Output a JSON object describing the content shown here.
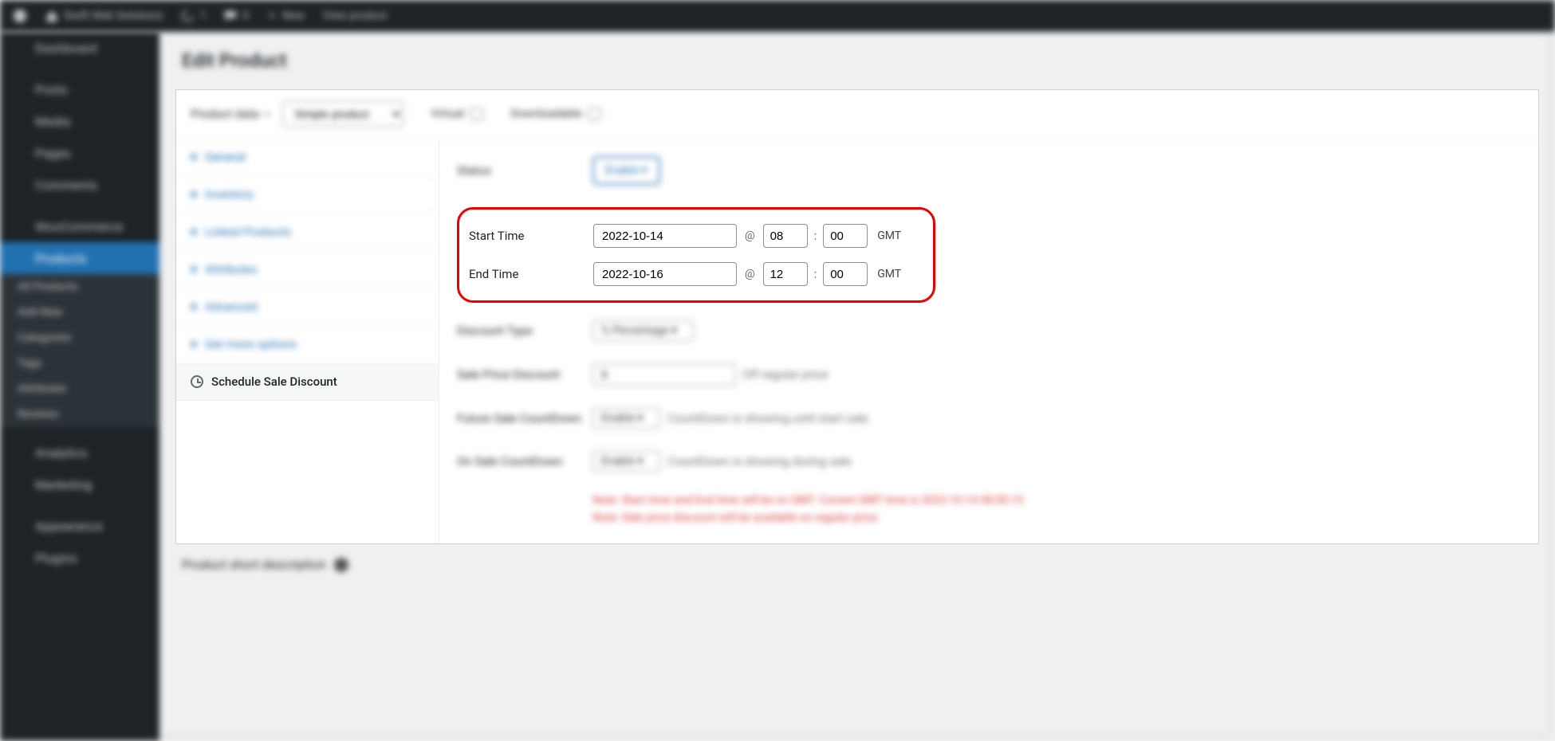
{
  "adminbar": {
    "site_name": "Swift Web Solutions",
    "comments_count": "0",
    "updates_count": "1",
    "new_label": "New",
    "view_product_label": "View product"
  },
  "sidebar": {
    "items": [
      {
        "label": "Dashboard"
      },
      {
        "label": "Posts"
      },
      {
        "label": "Media"
      },
      {
        "label": "Pages"
      },
      {
        "label": "Comments"
      },
      {
        "label": "WooCommerce"
      },
      {
        "label": "Products",
        "active": true
      },
      {
        "label": "All Products",
        "sub": true
      },
      {
        "label": "Add New",
        "sub": true
      },
      {
        "label": "Categories",
        "sub": true
      },
      {
        "label": "Tags",
        "sub": true
      },
      {
        "label": "Attributes",
        "sub": true
      },
      {
        "label": "Reviews",
        "sub": true
      },
      {
        "label": "Analytics"
      },
      {
        "label": "Marketing"
      },
      {
        "label": "Appearance"
      },
      {
        "label": "Plugins"
      }
    ]
  },
  "page": {
    "title": "Edit Product",
    "product_data_label": "Product data —",
    "product_type": "Simple product",
    "virtual_label": "Virtual:",
    "downloadable_label": "Downloadable:"
  },
  "tabs": [
    {
      "label": "General"
    },
    {
      "label": "Inventory"
    },
    {
      "label": "Linked Products"
    },
    {
      "label": "Attributes"
    },
    {
      "label": "Advanced"
    },
    {
      "label": "Get more options"
    },
    {
      "label": "Schedule Sale Discount",
      "active": true
    }
  ],
  "panel": {
    "status_label": "Status",
    "status_value": "Enable",
    "start_time_label": "Start Time",
    "end_time_label": "End Time",
    "start_date": "2022-10-14",
    "start_hour": "08",
    "start_min": "00",
    "end_date": "2022-10-16",
    "end_hour": "12",
    "end_min": "00",
    "at_symbol": "@",
    "colon": ":",
    "gmt": "GMT",
    "discount_type_label": "Discount Type",
    "discount_type_value": "% Percentage",
    "sale_price_discount_label": "Sale Price Discount",
    "sale_price_discount_value": "5",
    "sale_price_discount_suffix": "Off regular price",
    "future_cd_label": "Future Sale CountDown",
    "future_cd_value": "Enable",
    "future_cd_hint": "CountDown is showing until start sale",
    "on_cd_label": "On Sale CountDown",
    "on_cd_value": "Enable",
    "on_cd_hint": "CountDown is showing during sale",
    "note1": "Note: Start time and End time will be on GMT. Current GMT time is 2022-10-14 08:00:15",
    "note2": "Note: Sale price discount will be available on regular price."
  },
  "footer_section": {
    "short_desc_label": "Product short description"
  }
}
